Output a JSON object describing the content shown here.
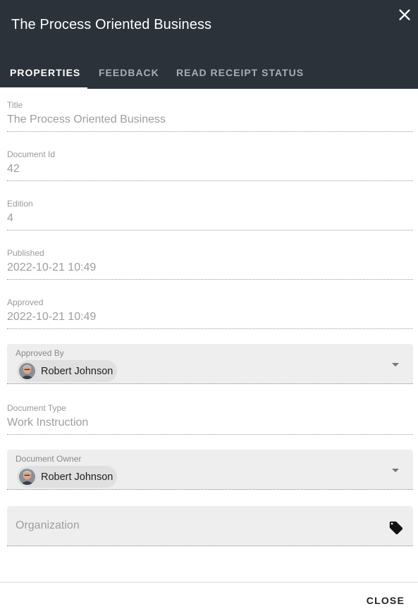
{
  "dialog": {
    "title": "The Process Oriented Business",
    "close_icon": "close-icon"
  },
  "tabs": [
    {
      "label": "PROPERTIES",
      "active": true
    },
    {
      "label": "FEEDBACK",
      "active": false
    },
    {
      "label": "READ RECEIPT STATUS",
      "active": false
    }
  ],
  "fields": {
    "title": {
      "label": "Title",
      "value": "The Process Oriented Business"
    },
    "document_id": {
      "label": "Document Id",
      "value": "42"
    },
    "edition": {
      "label": "Edition",
      "value": "4"
    },
    "published": {
      "label": "Published",
      "value": "2022-10-21 10:49"
    },
    "approved": {
      "label": "Approved",
      "value": "2022-10-21 10:49"
    },
    "approved_by": {
      "label": "Approved By",
      "value": "Robert Johnson"
    },
    "document_type": {
      "label": "Document Type",
      "value": "Work Instruction"
    },
    "document_owner": {
      "label": "Document Owner",
      "value": "Robert Johnson"
    },
    "organization": {
      "placeholder": "Organization",
      "icon": "tag-icon"
    }
  },
  "footer": {
    "close_label": "CLOSE"
  },
  "colors": {
    "header_bg": "#2b323a",
    "tab_inactive": "#a8aeb5",
    "field_bg": "#eeeeee"
  }
}
